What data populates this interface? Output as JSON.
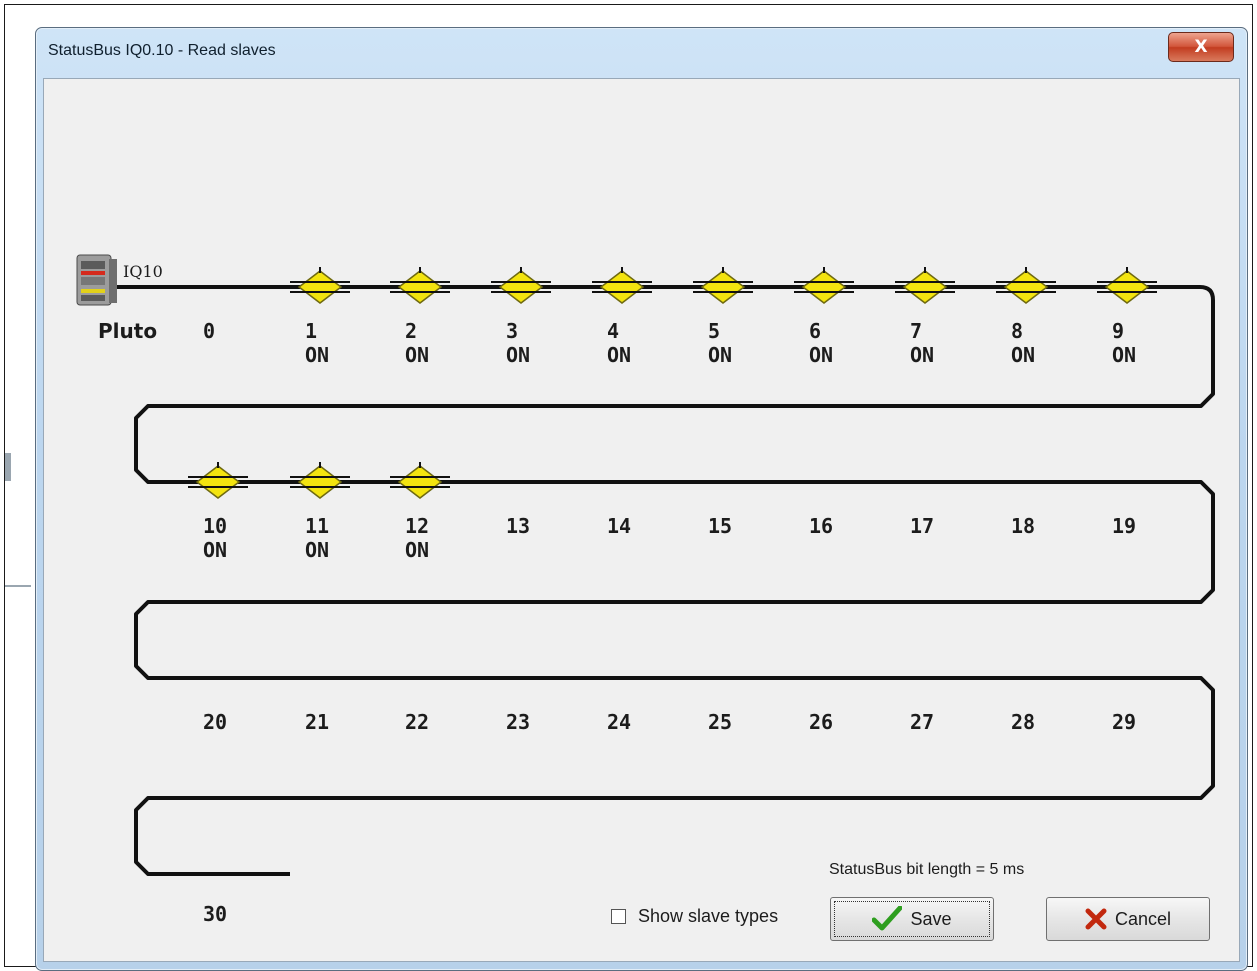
{
  "window": {
    "title": "StatusBus  IQ0.10 - Read slaves",
    "close_label": "X"
  },
  "controller": {
    "id_label": "IQ10",
    "name": "Pluto"
  },
  "slaves": [
    {
      "number": "0",
      "state": ""
    },
    {
      "number": "1",
      "state": "ON"
    },
    {
      "number": "2",
      "state": "ON"
    },
    {
      "number": "3",
      "state": "ON"
    },
    {
      "number": "4",
      "state": "ON"
    },
    {
      "number": "5",
      "state": "ON"
    },
    {
      "number": "6",
      "state": "ON"
    },
    {
      "number": "7",
      "state": "ON"
    },
    {
      "number": "8",
      "state": "ON"
    },
    {
      "number": "9",
      "state": "ON"
    },
    {
      "number": "10",
      "state": "ON"
    },
    {
      "number": "11",
      "state": "ON"
    },
    {
      "number": "12",
      "state": "ON"
    },
    {
      "number": "13",
      "state": ""
    },
    {
      "number": "14",
      "state": ""
    },
    {
      "number": "15",
      "state": ""
    },
    {
      "number": "16",
      "state": ""
    },
    {
      "number": "17",
      "state": ""
    },
    {
      "number": "18",
      "state": ""
    },
    {
      "number": "19",
      "state": ""
    },
    {
      "number": "20",
      "state": ""
    },
    {
      "number": "21",
      "state": ""
    },
    {
      "number": "22",
      "state": ""
    },
    {
      "number": "23",
      "state": ""
    },
    {
      "number": "24",
      "state": ""
    },
    {
      "number": "25",
      "state": ""
    },
    {
      "number": "26",
      "state": ""
    },
    {
      "number": "27",
      "state": ""
    },
    {
      "number": "28",
      "state": ""
    },
    {
      "number": "29",
      "state": ""
    },
    {
      "number": "30",
      "state": ""
    }
  ],
  "footer": {
    "bit_length_text": "StatusBus bit length = 5 ms",
    "show_slave_types_label": "Show slave types",
    "show_slave_types_checked": false,
    "save_label": "Save",
    "cancel_label": "Cancel"
  },
  "colors": {
    "slave_node_fill": "#f3e40f",
    "slave_node_stroke": "#6f6a10",
    "bus_line": "#111111",
    "save_check": "#2e9e1f",
    "cancel_x": "#c2280e"
  },
  "icons": {
    "controller": "pluto-plc-icon",
    "slave_node": "yellow-diamond-node-icon",
    "save": "green-checkmark-icon",
    "cancel": "red-x-icon",
    "close": "close-x-icon"
  }
}
